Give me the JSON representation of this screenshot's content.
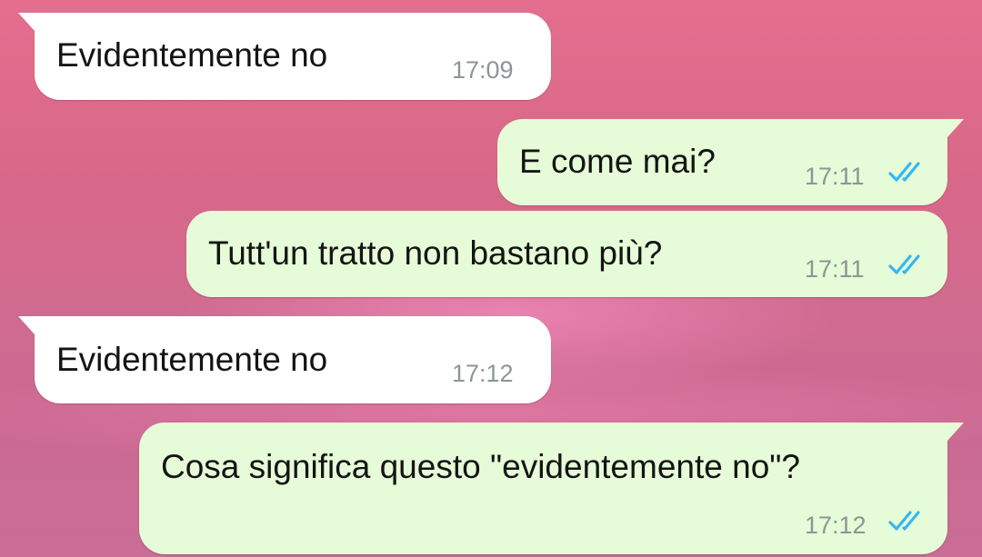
{
  "colors": {
    "incoming_bubble": "#ffffff",
    "outgoing_bubble": "#e6fbd7",
    "read_ticks": "#34b7f1",
    "timestamp": "#8d9596"
  },
  "messages": [
    {
      "direction": "incoming",
      "text": "Evidentemente no",
      "time": "17:09"
    },
    {
      "direction": "outgoing",
      "text": "E come mai?",
      "time": "17:11",
      "status_icon": "double-check-read-icon"
    },
    {
      "direction": "outgoing",
      "text": "Tutt'un tratto non bastano più?",
      "time": "17:11",
      "status_icon": "double-check-read-icon"
    },
    {
      "direction": "incoming",
      "text": "Evidentemente no",
      "time": "17:12"
    },
    {
      "direction": "outgoing",
      "text": "Cosa significa questo \"evidentemente no\"?",
      "time": "17:12",
      "status_icon": "double-check-read-icon"
    }
  ]
}
